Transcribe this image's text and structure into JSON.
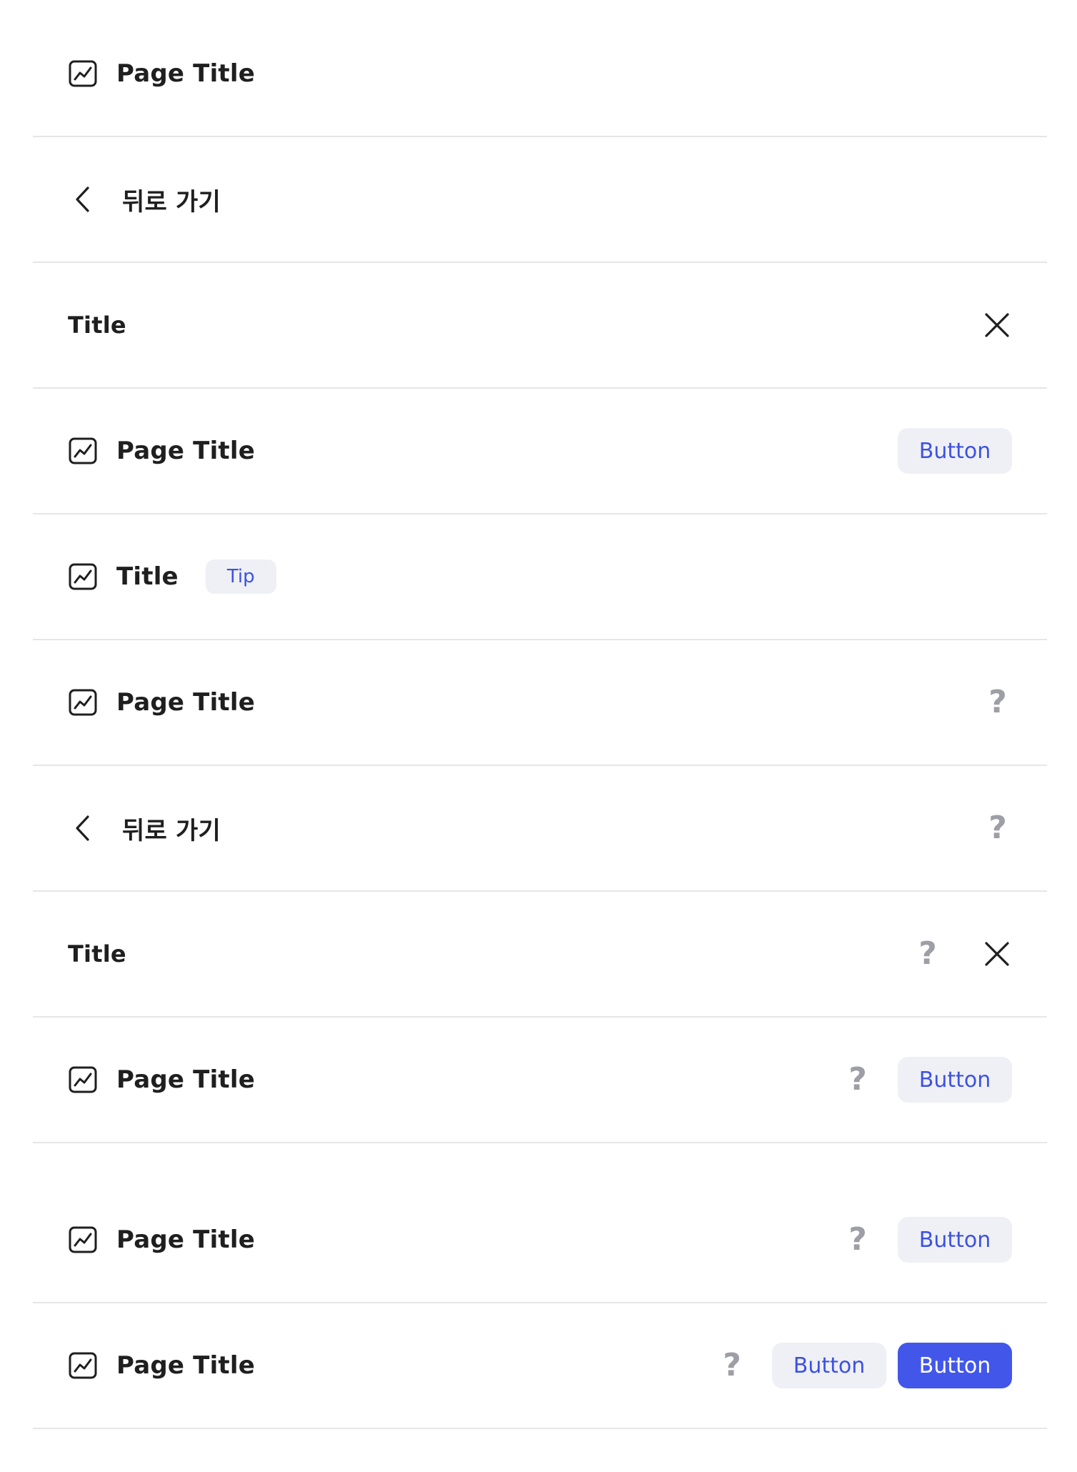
{
  "rows": [
    {
      "variant": "page-title",
      "title": "Page Title"
    },
    {
      "variant": "back",
      "title": "뒤로 가기"
    },
    {
      "variant": "modal",
      "title": "Title"
    },
    {
      "variant": "page-title-button",
      "title": "Page Title",
      "button": "Button"
    },
    {
      "variant": "title-tip",
      "title": "Title",
      "tip": "Tip"
    },
    {
      "variant": "page-title-help",
      "title": "Page Title",
      "help": "?"
    },
    {
      "variant": "back-help",
      "title": "뒤로 가기",
      "help": "?"
    },
    {
      "variant": "modal-help",
      "title": "Title",
      "help": "?"
    },
    {
      "variant": "page-title-help-button",
      "title": "Page Title",
      "help": "?",
      "button": "Button"
    },
    {
      "variant": "page-title-help-button",
      "title": "Page Title",
      "help": "?",
      "button": "Button"
    },
    {
      "variant": "page-title-help-two-buttons",
      "title": "Page Title",
      "help": "?",
      "button_secondary": "Button",
      "button_primary": "Button"
    }
  ],
  "icons": {
    "chart": "chart-icon",
    "back": "chevron-left-icon",
    "close": "close-icon"
  },
  "colors": {
    "accent": "#4257ea",
    "secondary_bg": "#eff0f6",
    "secondary_text": "#3d52e0",
    "help_icon": "#9e9ea6",
    "divider": "#e6e6e6"
  }
}
